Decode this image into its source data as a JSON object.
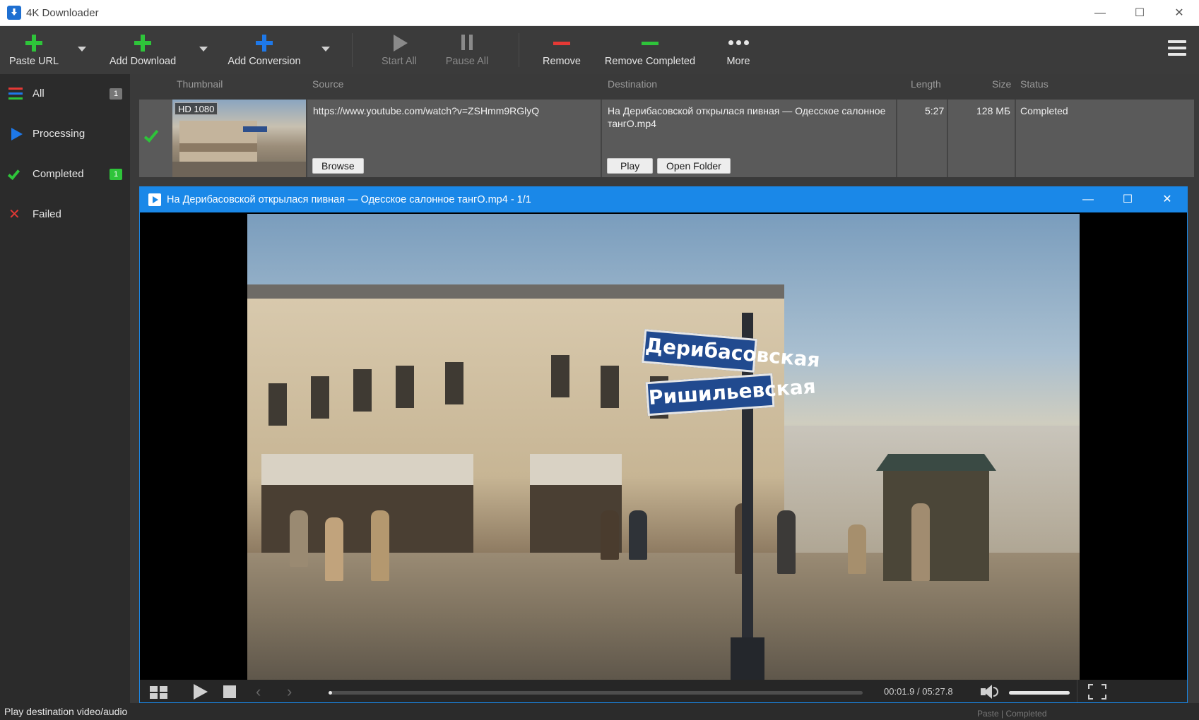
{
  "window": {
    "title": "4K Downloader",
    "controls": {
      "minimize": "—",
      "maximize": "☐",
      "close": "✕"
    }
  },
  "toolbar": {
    "paste_url": "Paste URL",
    "add_download": "Add Download",
    "add_conversion": "Add Conversion",
    "start_all": "Start All",
    "pause_all": "Pause All",
    "remove": "Remove",
    "remove_completed": "Remove Completed",
    "more": "More",
    "colors": {
      "green": "#2ec43a",
      "blue": "#1e78e8",
      "red": "#e53935",
      "disabled": "#8a8a8a"
    }
  },
  "sidebar": {
    "items": [
      {
        "label": "All",
        "badge": "1",
        "icon": "list-icon"
      },
      {
        "label": "Processing",
        "badge": "",
        "icon": "play-icon"
      },
      {
        "label": "Completed",
        "badge": "1",
        "icon": "check-icon"
      },
      {
        "label": "Failed",
        "badge": "",
        "icon": "x-icon"
      }
    ]
  },
  "columns": {
    "thumbnail": "Thumbnail",
    "source": "Source",
    "destination": "Destination",
    "length": "Length",
    "size": "Size",
    "status": "Status"
  },
  "rows": [
    {
      "quality": "HD 1080",
      "source": "https://www.youtube.com/watch?v=ZSHmm9RGlyQ",
      "destination": "На Дерибасовской открылася пивная — Одесское салонное тангО.mp4",
      "length": "5:27",
      "size": "128 МБ",
      "status": "Completed",
      "browse": "Browse",
      "play": "Play",
      "open_folder": "Open Folder"
    }
  ],
  "player": {
    "title": "На Дерибасовской открылася пивная — Одесское салонное тангО.mp4 - 1/1",
    "time": "00:01.9 / 05:27.8",
    "progress": 0.006,
    "volume": 1.0,
    "accent": "#1a88e8",
    "video_signs": [
      "Дерибасовская",
      "Ришильевская"
    ]
  },
  "statusbar": {
    "message": "Play destination video/audio",
    "right_text": "Paste | Completed"
  }
}
